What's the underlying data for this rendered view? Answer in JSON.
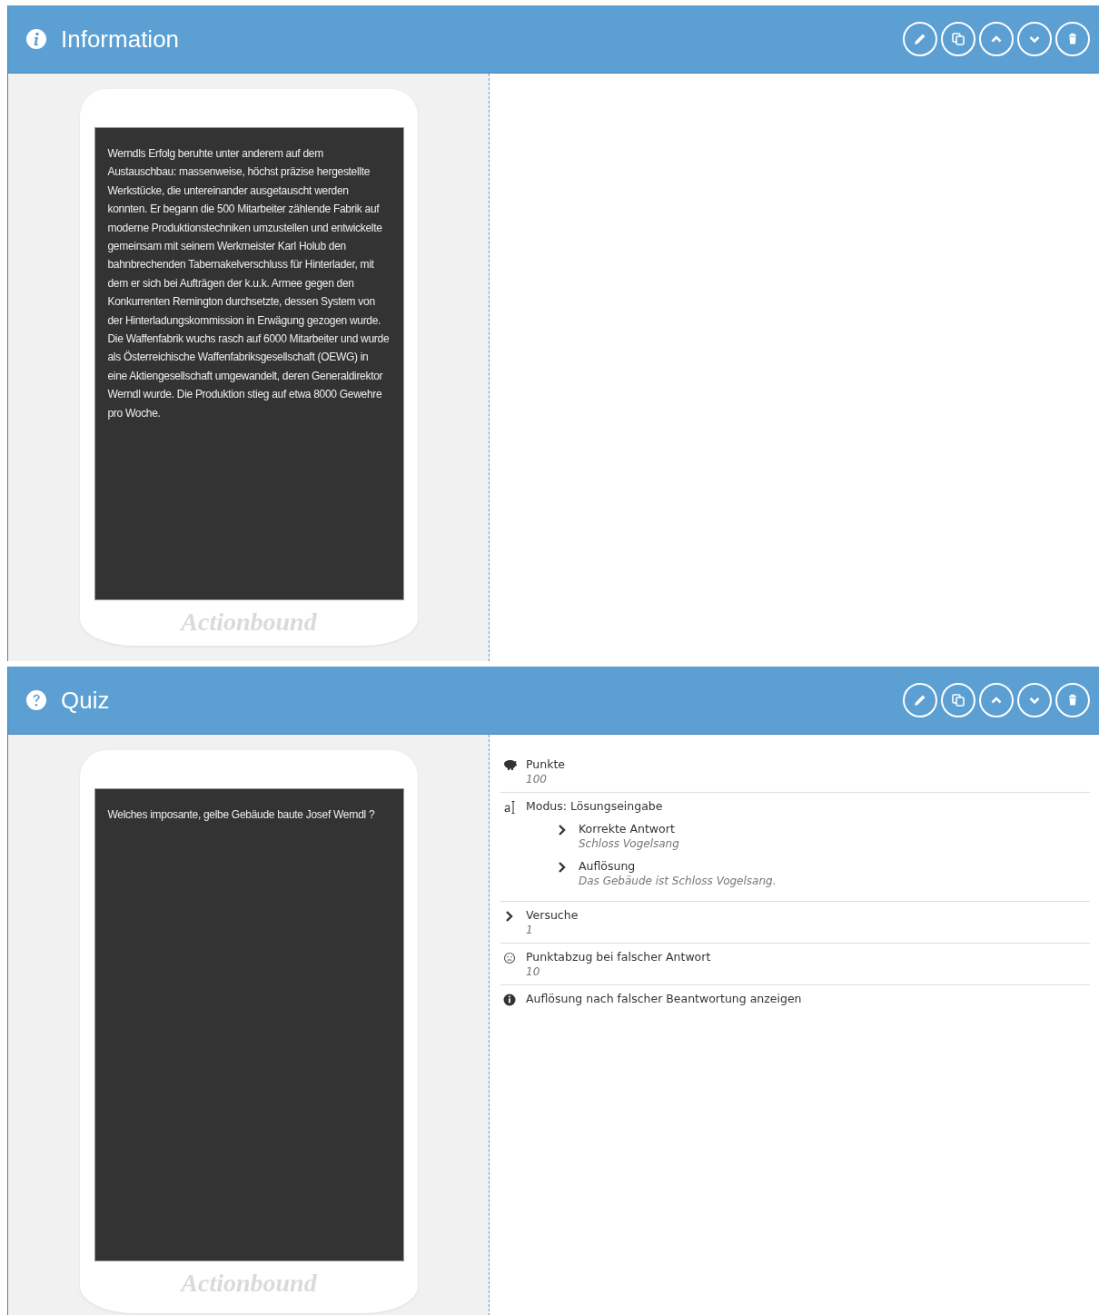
{
  "sections": [
    {
      "kind": "information",
      "title": "Information",
      "phone": {
        "text": "Werndls Erfolg beruhte unter anderem auf dem Austauschbau: massenweise, höchst präzise hergestellte Werkstücke, die untereinander ausgetauscht werden konnten. Er begann die 500 Mitarbeiter zählende Fabrik auf moderne Produktionstechniken umzustellen und entwickelte gemeinsam mit seinem Werkmeister Karl Holub den bahnbrechenden Tabernakelverschluss für Hinterlader, mit dem er sich bei Aufträgen der k.u.k. Armee gegen den Konkurrenten Remington durchsetzte, dessen System von der Hinterladungskommission in Erwägung gezogen wurde. Die Waffenfabrik wuchs rasch auf 6000 Mitarbeiter und wurde als Österreichische Waffenfabriksgesellschaft (OEWG) in eine Aktiengesellschaft umgewandelt, deren Generaldirektor Werndl wurde. Die Produktion stieg auf etwa 8000 Gewehre pro Woche.",
        "brand": "Actionbound"
      }
    },
    {
      "kind": "quiz",
      "title": "Quiz",
      "phone": {
        "text": "Welches imposante, gelbe Gebäude baute Josef Werndl ?",
        "brand": "Actionbound"
      },
      "details": [
        {
          "kind": "points",
          "label": "Punkte",
          "value": "100"
        },
        {
          "kind": "mode",
          "label": "Modus: Lösungseingabe",
          "children": [
            {
              "kind": "chevron",
              "label": "Korrekte Antwort",
              "value": "Schloss Vogelsang"
            },
            {
              "kind": "chevron",
              "label": "Auflösung",
              "value": "Das Gebäude ist Schloss Vogelsang."
            }
          ]
        },
        {
          "kind": "chevron",
          "label": "Versuche",
          "value": "1"
        },
        {
          "kind": "penalty",
          "label": "Punktabzug bei falscher Antwort",
          "value": "10"
        },
        {
          "kind": "info",
          "label": "Auflösung nach falscher Beantwortung anzeigen"
        }
      ]
    }
  ]
}
